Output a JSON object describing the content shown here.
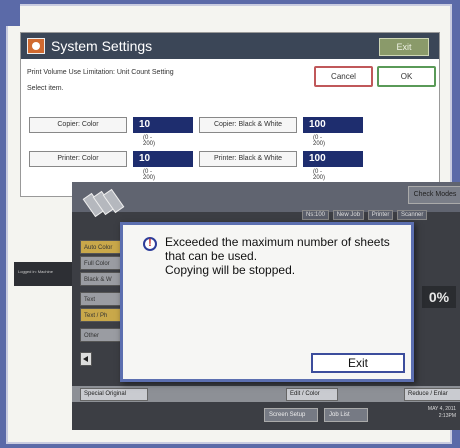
{
  "system_settings": {
    "title": "System Settings",
    "exit_label": "Exit",
    "subtitle": "Print Volume Use Limitation: Unit Count Setting",
    "instruction": "Select item.",
    "cancel_label": "Cancel",
    "ok_label": "OK",
    "limits": [
      {
        "label": "Copier: Color",
        "value": "10",
        "range": "(0 - 200)"
      },
      {
        "label": "Copier: Black & White",
        "value": "100",
        "range": "(0 - 200)"
      },
      {
        "label": "Printer: Color",
        "value": "10",
        "range": "(0 - 200)"
      },
      {
        "label": "Printer: Black & White",
        "value": "100",
        "range": "(0 - 200)"
      }
    ]
  },
  "copier": {
    "check_modes_label": "Check Modes",
    "tabs": [
      "Ns:100",
      "New Job",
      "Printer",
      "Scanner"
    ],
    "side_buttons": [
      "Auto Color",
      "Full Color",
      "Black & W",
      "Text",
      "Text / Ph",
      "Other"
    ],
    "zoom_label": "0%",
    "bottom_buttons": [
      "Special Original",
      "Edit / Color",
      "Reduce / Enlar"
    ],
    "bottom_buttons2": [
      "Screen Setup",
      "Job List"
    ],
    "clock_date": "MAY 4, 2011",
    "clock_time": "2:13PM",
    "left_screen_text": "Logged in: Machine"
  },
  "dialog": {
    "icon": "warning-icon",
    "message_line1": "Exceeded the maximum number of sheets",
    "message_line2": "that can be used.",
    "message_line3": "Copying will be stopped.",
    "exit_label": "Exit"
  },
  "colors": {
    "background": "#5b6aa8",
    "title_bar": "#3b4657",
    "value_box": "#1e2d6e",
    "dialog_border": "#5c6fb0"
  }
}
